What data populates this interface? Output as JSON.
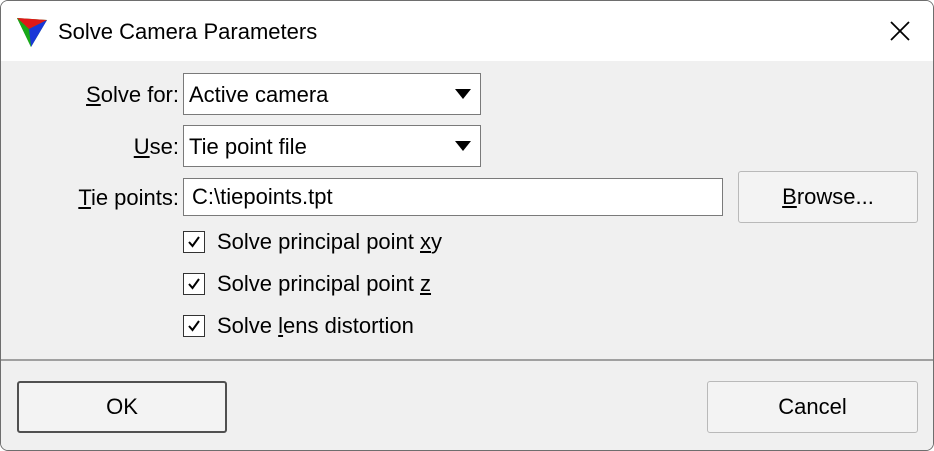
{
  "window": {
    "title": "Solve Camera Parameters"
  },
  "form": {
    "solve_for": {
      "label_access": "S",
      "label_rest": "olve for:",
      "value": "Active camera"
    },
    "use": {
      "label_access": "U",
      "label_rest": "se:",
      "value": "Tie point file"
    },
    "tie_points": {
      "label_access": "T",
      "label_rest": "ie points:",
      "value": "C:\\tiepoints.tpt"
    },
    "browse_button": {
      "label_access": "B",
      "label_rest": "rowse..."
    },
    "checkboxes": [
      {
        "label_before": "Solve principal point ",
        "label_access": "x",
        "label_after": "y",
        "checked": true
      },
      {
        "label_before": "Solve principal point ",
        "label_access": "z",
        "label_after": "",
        "checked": true
      },
      {
        "label_before": "Solve ",
        "label_access": "l",
        "label_after": "ens distortion",
        "checked": true
      }
    ]
  },
  "footer": {
    "ok_label": "OK",
    "cancel_label": "Cancel"
  },
  "icons": {
    "app_icon": "tricolor-triangle-icon",
    "close_icon": "close-icon",
    "dropdown_icon": "chevron-down-icon",
    "check_icon": "checkmark-icon"
  }
}
